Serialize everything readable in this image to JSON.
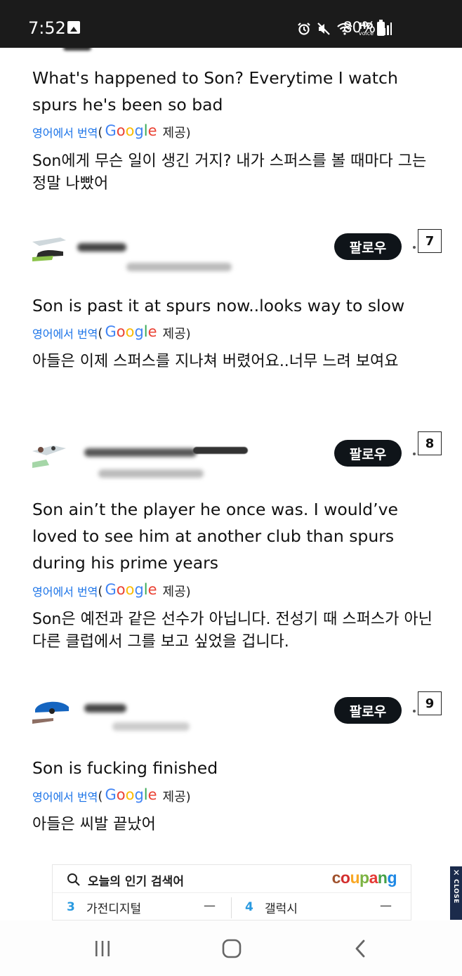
{
  "status_bar": {
    "time": "7:52",
    "hd_label": "HD",
    "voice_label": "voice",
    "battery": "80%",
    "icons": [
      "image-icon",
      "alarm-icon",
      "mute-icon",
      "wifi-icon",
      "hd-voice-icon",
      "signal-icon",
      "battery-icon"
    ]
  },
  "translation": {
    "link": "영어에서 번역",
    "open_paren": "(",
    "google_letters": [
      "G",
      "o",
      "o",
      "g",
      "l",
      "e"
    ],
    "provided": "제공)"
  },
  "comments": [
    {
      "text": "What's happened to Son? Everytime I watch spurs he's been so bad",
      "translated": "Son에게 무슨 일이 생긴 거지? 내가 스퍼스를 볼 때마다 그는 정말 나빴어"
    },
    {
      "text": "Son is past it at spurs now..looks way to slow",
      "translated": "아들은 이제 스퍼스를 지나쳐 버렸어요..너무 느려 보여요",
      "follow_label": "팔로우",
      "badge": "7"
    },
    {
      "text": "Son ain’t the player he once was. I would’ve loved to see him at another club than spurs during his prime years",
      "translated": "Son은 예전과 같은 선수가 아닙니다. 전성기 때 스퍼스가 아닌 다른 클럽에서 그를 보고 싶었을 겁니다.",
      "follow_label": "팔로우",
      "badge": "8"
    },
    {
      "text": "Son is fucking finished",
      "translated": "아들은 씨발 끝났어",
      "follow_label": "팔로우",
      "badge": "9"
    }
  ],
  "ad": {
    "title": "오늘의 인기 검색어",
    "brand": "coupang",
    "items": [
      {
        "rank": "3",
        "label": "가전디지털",
        "trend": "—"
      },
      {
        "rank": "4",
        "label": "갤럭시",
        "trend": "—"
      }
    ],
    "close_x": "✕",
    "close_label": "CLOSE"
  },
  "nav": {
    "icons": [
      "recent-apps-icon",
      "home-icon",
      "back-icon"
    ]
  }
}
